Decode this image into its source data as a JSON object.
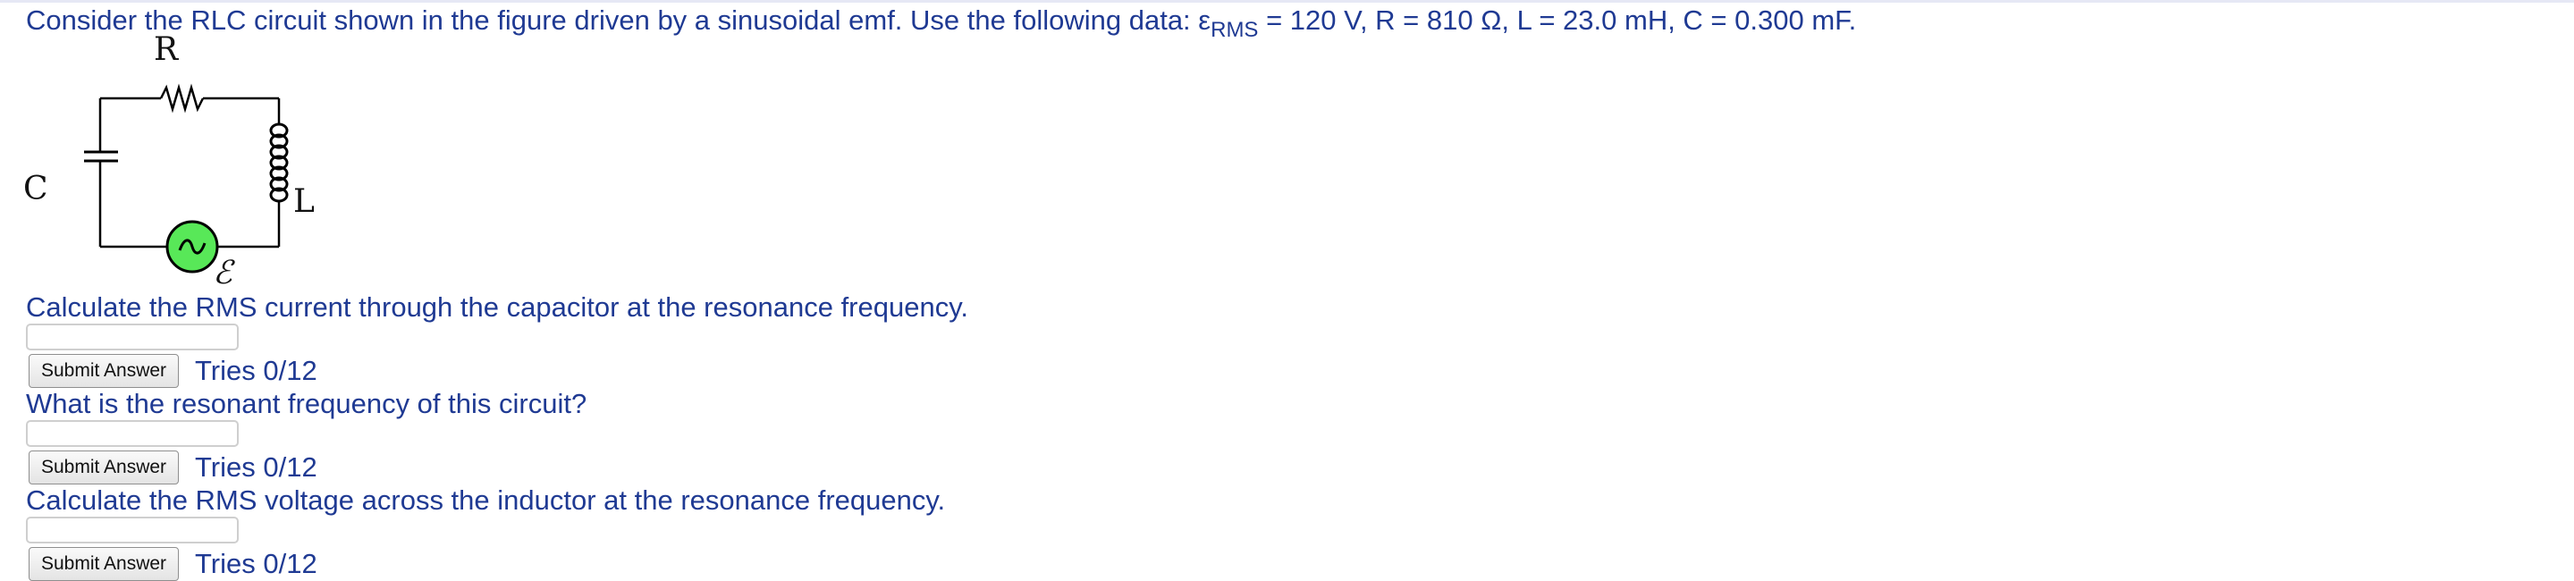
{
  "problem": {
    "intro_prefix": "Consider the RLC circuit shown in the figure driven by a sinusoidal emf. Use the following data: ε",
    "emf_subscript": "RMS",
    "intro_suffix": " = 120 V, R = 810 Ω, L = 23.0 mH, C = 0.300 mF."
  },
  "figure": {
    "label_R": "R",
    "label_C": "C",
    "label_L": "L",
    "label_emf": "ℰ",
    "source_fill": "#58e858",
    "wire_color": "#000000"
  },
  "questions": [
    {
      "prompt": "Calculate the RMS current through the capacitor at the resonance frequency.",
      "answer_value": "",
      "submit_label": "Submit Answer",
      "tries": "Tries 0/12"
    },
    {
      "prompt": "What is the resonant frequency of this circuit?",
      "answer_value": "",
      "submit_label": "Submit Answer",
      "tries": "Tries 0/12"
    },
    {
      "prompt": "Calculate the RMS voltage across the inductor at the resonance frequency.",
      "answer_value": "",
      "submit_label": "Submit Answer",
      "tries": "Tries 0/12"
    }
  ],
  "colors": {
    "text": "#1f3a93",
    "background": "#ffffff"
  }
}
